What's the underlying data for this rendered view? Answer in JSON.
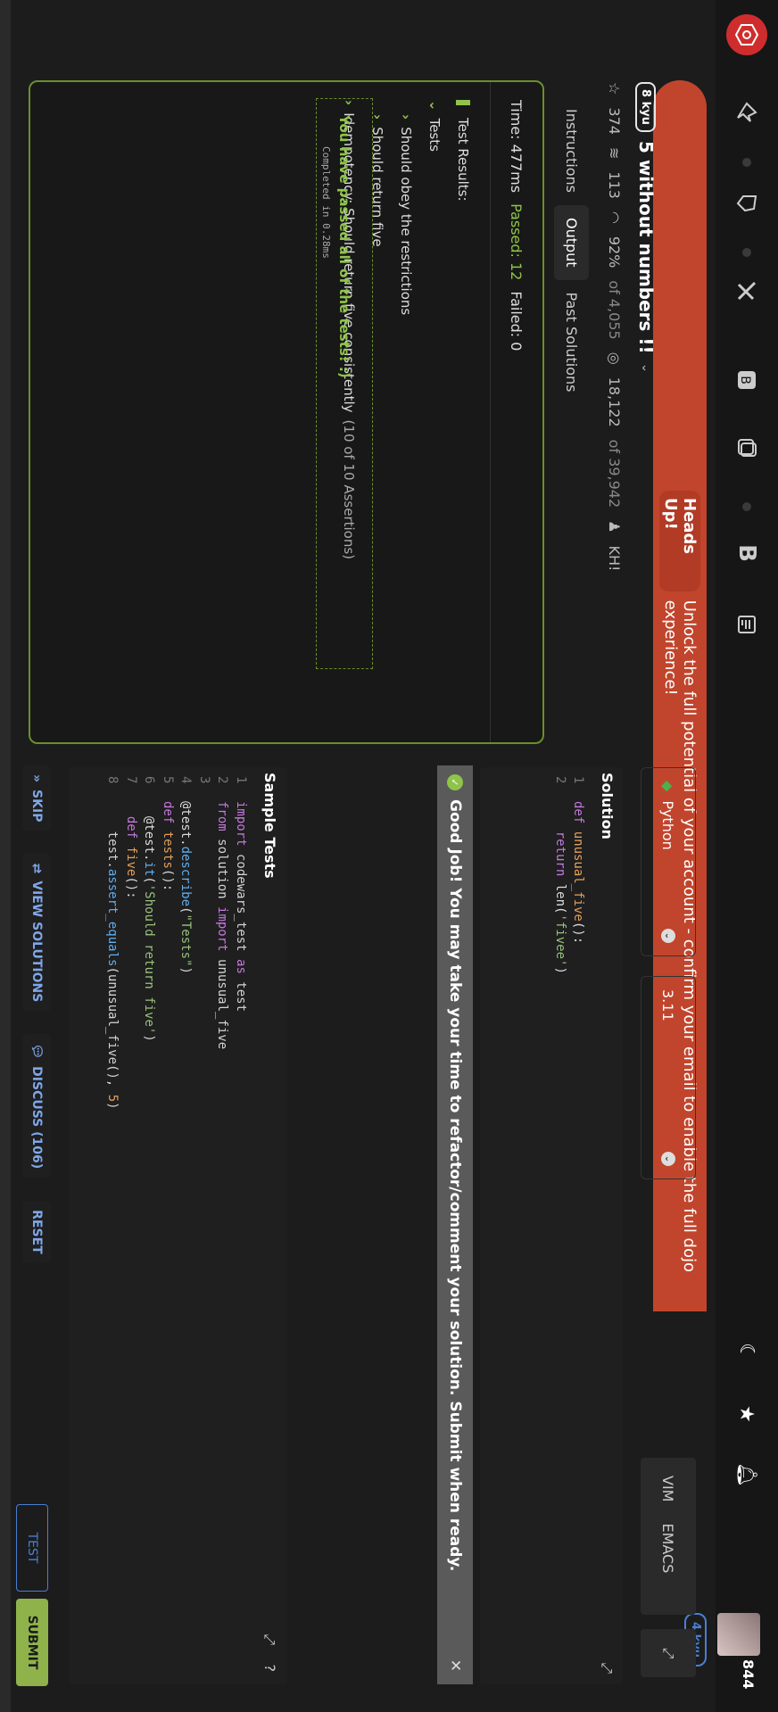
{
  "nav": {
    "icons": [
      "logo-icon",
      "ninja-icon",
      "kata-icon",
      "challenge-icon",
      "feedback-icon",
      "badge-icon",
      "clan-icon",
      "bold-icon",
      "document-icon"
    ],
    "rank_badge": "4 kyu",
    "honor": "844",
    "right_icons": [
      "moon-icon",
      "star-icon",
      "bell-icon"
    ]
  },
  "banner": {
    "tag": "Heads Up!",
    "text": "Unlock the full potential of your account - confirm your email to enable the full dojo experience!"
  },
  "kata": {
    "kyu": "8 kyu",
    "title": "5 without numbers !!",
    "stars": "374",
    "collections": "113",
    "satisfaction": "92%",
    "satisfaction_of": "of 4,055",
    "completions": "18,122",
    "completions_of": "of 39,942",
    "author": "KH!"
  },
  "tabs": [
    "Instructions",
    "Output",
    "Past Solutions"
  ],
  "output": {
    "time": "Time: 477ms",
    "passed": "Passed: 12",
    "failed": "Failed: 0",
    "header": "Test Results:",
    "group": "Tests",
    "items": [
      "Should obey the restrictions",
      "Should return five",
      "Idempotency: Should return five consistently"
    ],
    "assertions": "(10 of 10 Assertions)",
    "completed": "Completed in 0.28ms",
    "pass_message": "You have passed all of the tests! :)"
  },
  "editor": {
    "language": "Python",
    "version": "3.11",
    "modes": [
      "VIM",
      "EMACS"
    ],
    "solution_title": "Solution",
    "good_job": "Good Job! You may take your time to refactor/comment your solution. Submit when ready.",
    "tests_title": "Sample Tests"
  },
  "actions": {
    "skip": "SKIP",
    "view_solutions": "VIEW SOLUTIONS",
    "discuss": "DISCUSS (106)",
    "reset": "RESET",
    "test": "TEST",
    "submit": "SUBMIT"
  }
}
